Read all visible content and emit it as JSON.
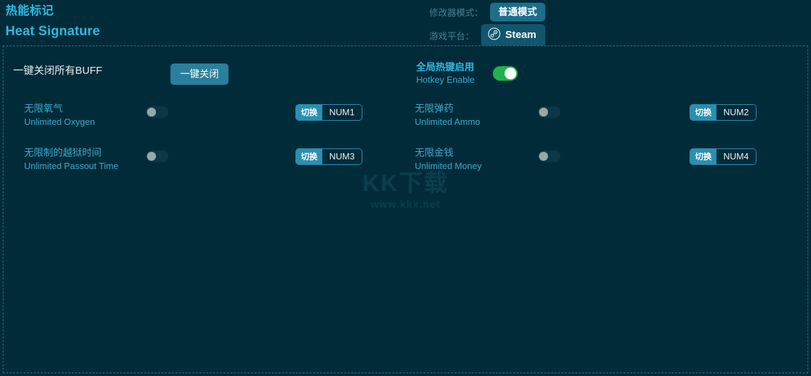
{
  "header": {
    "title_cn": "热能标记",
    "title_en": "Heat Signature",
    "mode_label": "修改器模式：",
    "mode_value": "普通模式",
    "platform_label": "游戏平台：",
    "platform_value": "Steam",
    "platform_icon": "steam-icon"
  },
  "global": {
    "buff_label": "一键关闭所有BUFF",
    "buff_button": "一键关闭",
    "hotkey_cn": "全局热键启用",
    "hotkey_en": "Hotkey Enable",
    "hotkey_state": "on"
  },
  "cheats": [
    {
      "name_cn": "无限氧气",
      "name_en": "Unlimited Oxygen",
      "state": "off",
      "hotkey_action": "切换",
      "hotkey_key": "NUM1"
    },
    {
      "name_cn": "无限弹药",
      "name_en": "Unlimited Ammo",
      "state": "off",
      "hotkey_action": "切换",
      "hotkey_key": "NUM2"
    },
    {
      "name_cn": "无限制的越狱时间",
      "name_en": "Unlimited Passout Time",
      "state": "off",
      "hotkey_action": "切换",
      "hotkey_key": "NUM3"
    },
    {
      "name_cn": "无限金钱",
      "name_en": "Unlimited Money",
      "state": "off",
      "hotkey_action": "切换",
      "hotkey_key": "NUM4"
    }
  ],
  "watermark": {
    "logo": "KK下载",
    "url": "www.kkx.net"
  },
  "colors": {
    "background": "#022b3a",
    "accent": "#2fb9e0",
    "button": "#2a7f9c",
    "toggle_on": "#21b24a",
    "toggle_off": "#0b3747",
    "border_dashed": "#2a6f80"
  }
}
